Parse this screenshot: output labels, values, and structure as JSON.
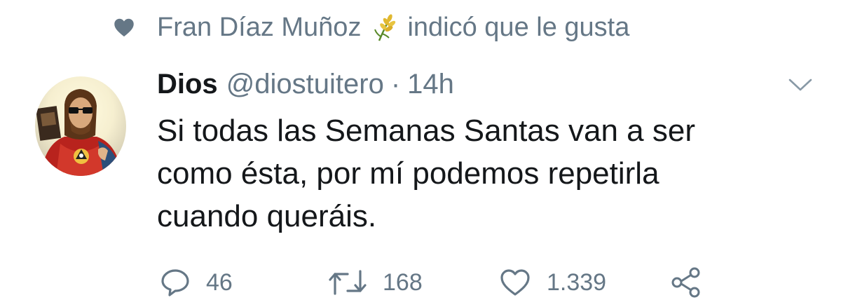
{
  "social_context": {
    "user": "Fran Díaz Muñoz",
    "action": "indicó que le gusta",
    "icon": "heart-icon",
    "emoji": "wheat-emoji"
  },
  "tweet": {
    "author_name": "Dios",
    "handle": "@diostuitero",
    "separator": "·",
    "time": "14h",
    "text_lines": [
      "Si todas las Semanas Santas van a ser",
      "como ésta, por mí podemos repetirla",
      "cuando queráis."
    ]
  },
  "actions": {
    "replies": "46",
    "retweets": "168",
    "likes": "1.339"
  },
  "colors": {
    "text": "#14171a",
    "secondary": "#657786",
    "background": "#ffffff"
  }
}
